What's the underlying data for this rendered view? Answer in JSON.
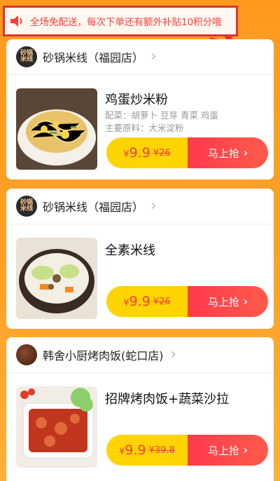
{
  "notice": {
    "text": "全场免配送，每次下单还有额外补贴10积分哦",
    "icon": "speaker-icon",
    "accent": "#ff3b3b",
    "annotation_color": "#e4322b"
  },
  "cards": [
    {
      "shop": "砂锅米线（福园店）",
      "logo_text": "砂锅\n米线",
      "dish": "鸡蛋炒米粉",
      "meta1": "配菜：胡萝卜 豆芽 青菜 鸡蛋",
      "meta2": "主要原料：大米淀粉",
      "currency": "¥",
      "price": "9.9",
      "orig": "¥26",
      "cta": "马上抢"
    },
    {
      "shop": "砂锅米线（福园店）",
      "logo_text": "砂锅\n米线",
      "dish": "全素米线",
      "currency": "¥",
      "price": "9.9",
      "orig": "¥26",
      "cta": "马上抢"
    },
    {
      "shop": "韩舍小厨烤肉饭(蛇口店)",
      "dish": "招牌烤肉饭+蔬菜沙拉",
      "currency": "¥",
      "price": "9.9",
      "orig": "¥39.8",
      "cta": "马上抢"
    }
  ],
  "colors": {
    "price_bg": "#ffd400",
    "cta_bg": "#ff3a4d",
    "page_bg": "#ffa22a"
  }
}
